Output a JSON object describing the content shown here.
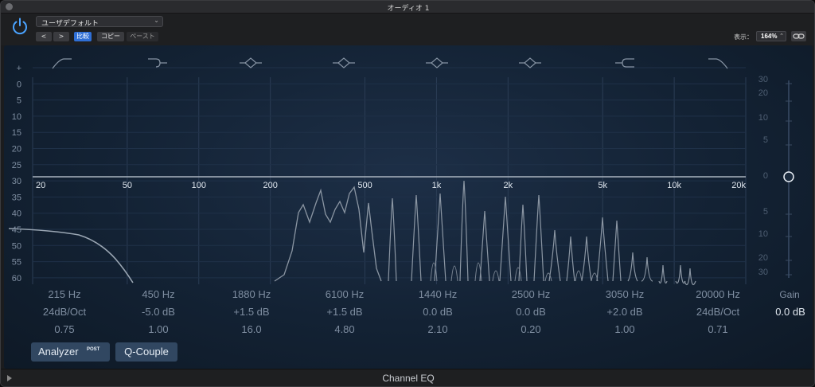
{
  "window": {
    "title": "オーディオ 1"
  },
  "header": {
    "preset": "ユーザデフォルト",
    "prev": "<",
    "next": ">",
    "compare": "比較",
    "copy": "コピー",
    "paste": "ペースト",
    "view_label": "表示：",
    "zoom": "164%"
  },
  "eq": {
    "left_scale": [
      "+",
      "0",
      "5",
      "10",
      "15",
      "20",
      "25",
      "30",
      "35",
      "40",
      "45",
      "50",
      "55",
      "60",
      "-"
    ],
    "right_scale_upper": [
      "30",
      "20",
      "10",
      "5",
      "0"
    ],
    "right_scale_lower": [
      "5",
      "10",
      "20",
      "30"
    ],
    "freq_ticks": [
      {
        "label": "20",
        "hz": 20
      },
      {
        "label": "50",
        "hz": 50
      },
      {
        "label": "100",
        "hz": 100
      },
      {
        "label": "200",
        "hz": 200
      },
      {
        "label": "500",
        "hz": 500
      },
      {
        "label": "1k",
        "hz": 1000
      },
      {
        "label": "2k",
        "hz": 2000
      },
      {
        "label": "5k",
        "hz": 5000
      },
      {
        "label": "10k",
        "hz": 10000
      },
      {
        "label": "20k",
        "hz": 20000
      }
    ],
    "bands": [
      {
        "icon": "high-pass-icon",
        "freq": "215 Hz",
        "slope": "24dB/Oct",
        "q": "0.75"
      },
      {
        "icon": "low-shelf-icon",
        "freq": "450 Hz",
        "slope": "-5.0 dB",
        "q": "1.00"
      },
      {
        "icon": "bell-icon",
        "freq": "1880 Hz",
        "slope": "+1.5 dB",
        "q": "16.0"
      },
      {
        "icon": "bell-icon",
        "freq": "6100 Hz",
        "slope": "+1.5 dB",
        "q": "4.80"
      },
      {
        "icon": "bell-icon",
        "freq": "1440 Hz",
        "slope": "0.0 dB",
        "q": "2.10"
      },
      {
        "icon": "bell-icon",
        "freq": "2500 Hz",
        "slope": "0.0 dB",
        "q": "0.20"
      },
      {
        "icon": "high-shelf-icon",
        "freq": "3050 Hz",
        "slope": "+2.0 dB",
        "q": "1.00"
      },
      {
        "icon": "low-pass-icon",
        "freq": "20000 Hz",
        "slope": "24dB/Oct",
        "q": "0.71"
      }
    ],
    "gain_label": "Gain",
    "gain_value": "0.0 dB"
  },
  "buttons": {
    "analyzer": "Analyzer",
    "analyzer_badge": "POST",
    "qcouple": "Q-Couple"
  },
  "footer": {
    "title": "Channel EQ"
  },
  "colors": {
    "background": "#132234",
    "accent_blue": "#2f6fd6",
    "curve": "#9aa6b3"
  }
}
